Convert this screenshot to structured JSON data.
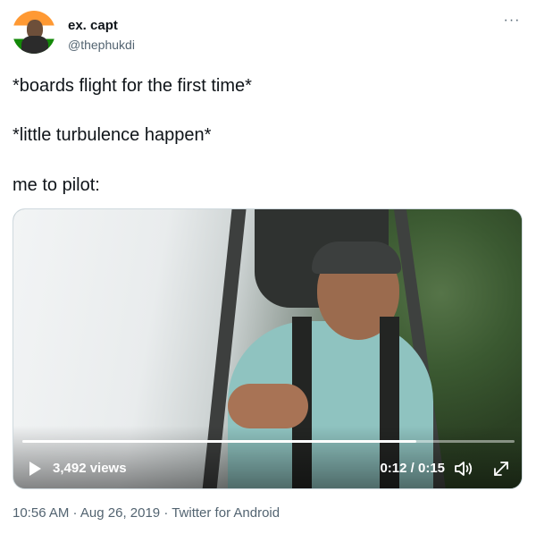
{
  "author": {
    "display_name": "ex. capt",
    "handle": "@thephukdi",
    "avatar_icon": "avatar-india-flag"
  },
  "header": {
    "more_icon": "more-horizontal-icon",
    "more_glyph": "···"
  },
  "tweet": {
    "lines": [
      "*boards flight for the first time*",
      "*little turbulence happen*",
      "me to pilot:"
    ]
  },
  "video": {
    "views": "3,492 views",
    "time": "0:12 / 0:15",
    "progress": 0.8,
    "play_icon": "play-icon",
    "volume_icon": "volume-icon",
    "expand_icon": "expand-icon"
  },
  "meta": {
    "time": "10:56 AM",
    "separator": " · ",
    "date": "Aug 26, 2019",
    "source": "Twitter for Android"
  },
  "colors": {
    "text_primary": "#0f1419",
    "text_secondary": "#536471",
    "border": "#cfd9de"
  }
}
